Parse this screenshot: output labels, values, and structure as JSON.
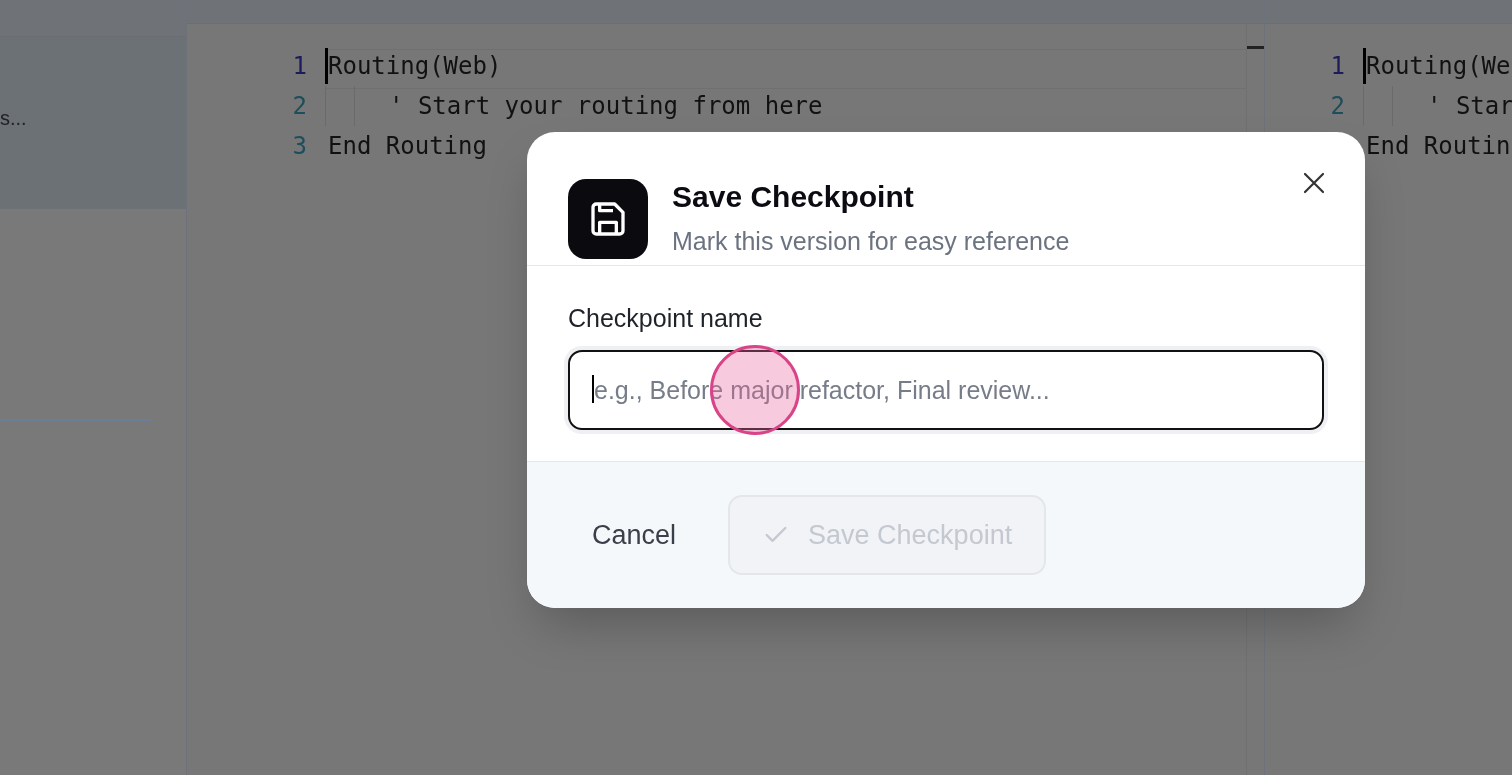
{
  "sidebar": {
    "text": "s..."
  },
  "editors": [
    {
      "kind": "main",
      "lines": [
        {
          "number": "1",
          "code": "Routing(Web)",
          "kind": "block"
        },
        {
          "number": "2",
          "code": "' Start your routing from here",
          "kind": "nested"
        },
        {
          "number": "3",
          "code": "End Routing",
          "kind": "block"
        }
      ]
    },
    {
      "kind": "side",
      "lines": [
        {
          "number": "1",
          "code": "Routing(We",
          "kind": "block"
        },
        {
          "number": "2",
          "code": "' Star",
          "kind": "nested"
        },
        {
          "code": "End Routin",
          "kind": "block"
        }
      ]
    }
  ],
  "dialog": {
    "title": "Save Checkpoint",
    "subtitle": "Mark this version for easy reference",
    "field_label": "Checkpoint name",
    "field": {
      "placeholder": "e.g., Before major refactor, Final review...",
      "focused": true
    },
    "buttons": [
      {
        "label": "Cancel",
        "kind": "text",
        "disabled": false
      },
      {
        "label": "Save Checkpoint",
        "kind": "primary",
        "disabled": true
      }
    ]
  }
}
